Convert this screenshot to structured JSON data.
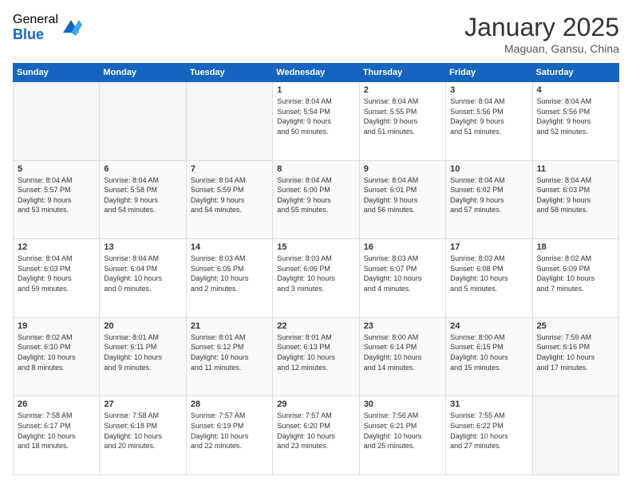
{
  "logo": {
    "general": "General",
    "blue": "Blue"
  },
  "header": {
    "title": "January 2025",
    "subtitle": "Maguan, Gansu, China"
  },
  "weekdays": [
    "Sunday",
    "Monday",
    "Tuesday",
    "Wednesday",
    "Thursday",
    "Friday",
    "Saturday"
  ],
  "weeks": [
    [
      {
        "day": "",
        "info": ""
      },
      {
        "day": "",
        "info": ""
      },
      {
        "day": "",
        "info": ""
      },
      {
        "day": "1",
        "info": "Sunrise: 8:04 AM\nSunset: 5:54 PM\nDaylight: 9 hours\nand 50 minutes."
      },
      {
        "day": "2",
        "info": "Sunrise: 8:04 AM\nSunset: 5:55 PM\nDaylight: 9 hours\nand 51 minutes."
      },
      {
        "day": "3",
        "info": "Sunrise: 8:04 AM\nSunset: 5:56 PM\nDaylight: 9 hours\nand 51 minutes."
      },
      {
        "day": "4",
        "info": "Sunrise: 8:04 AM\nSunset: 5:56 PM\nDaylight: 9 hours\nand 52 minutes."
      }
    ],
    [
      {
        "day": "5",
        "info": "Sunrise: 8:04 AM\nSunset: 5:57 PM\nDaylight: 9 hours\nand 53 minutes."
      },
      {
        "day": "6",
        "info": "Sunrise: 8:04 AM\nSunset: 5:58 PM\nDaylight: 9 hours\nand 54 minutes."
      },
      {
        "day": "7",
        "info": "Sunrise: 8:04 AM\nSunset: 5:59 PM\nDaylight: 9 hours\nand 54 minutes."
      },
      {
        "day": "8",
        "info": "Sunrise: 8:04 AM\nSunset: 6:00 PM\nDaylight: 9 hours\nand 55 minutes."
      },
      {
        "day": "9",
        "info": "Sunrise: 8:04 AM\nSunset: 6:01 PM\nDaylight: 9 hours\nand 56 minutes."
      },
      {
        "day": "10",
        "info": "Sunrise: 8:04 AM\nSunset: 6:02 PM\nDaylight: 9 hours\nand 57 minutes."
      },
      {
        "day": "11",
        "info": "Sunrise: 8:04 AM\nSunset: 6:03 PM\nDaylight: 9 hours\nand 58 minutes."
      }
    ],
    [
      {
        "day": "12",
        "info": "Sunrise: 8:04 AM\nSunset: 6:03 PM\nDaylight: 9 hours\nand 59 minutes."
      },
      {
        "day": "13",
        "info": "Sunrise: 8:04 AM\nSunset: 6:04 PM\nDaylight: 10 hours\nand 0 minutes."
      },
      {
        "day": "14",
        "info": "Sunrise: 8:03 AM\nSunset: 6:05 PM\nDaylight: 10 hours\nand 2 minutes."
      },
      {
        "day": "15",
        "info": "Sunrise: 8:03 AM\nSunset: 6:06 PM\nDaylight: 10 hours\nand 3 minutes."
      },
      {
        "day": "16",
        "info": "Sunrise: 8:03 AM\nSunset: 6:07 PM\nDaylight: 10 hours\nand 4 minutes."
      },
      {
        "day": "17",
        "info": "Sunrise: 8:03 AM\nSunset: 6:08 PM\nDaylight: 10 hours\nand 5 minutes."
      },
      {
        "day": "18",
        "info": "Sunrise: 8:02 AM\nSunset: 6:09 PM\nDaylight: 10 hours\nand 7 minutes."
      }
    ],
    [
      {
        "day": "19",
        "info": "Sunrise: 8:02 AM\nSunset: 6:10 PM\nDaylight: 10 hours\nand 8 minutes."
      },
      {
        "day": "20",
        "info": "Sunrise: 8:01 AM\nSunset: 6:11 PM\nDaylight: 10 hours\nand 9 minutes."
      },
      {
        "day": "21",
        "info": "Sunrise: 8:01 AM\nSunset: 6:12 PM\nDaylight: 10 hours\nand 11 minutes."
      },
      {
        "day": "22",
        "info": "Sunrise: 8:01 AM\nSunset: 6:13 PM\nDaylight: 10 hours\nand 12 minutes."
      },
      {
        "day": "23",
        "info": "Sunrise: 8:00 AM\nSunset: 6:14 PM\nDaylight: 10 hours\nand 14 minutes."
      },
      {
        "day": "24",
        "info": "Sunrise: 8:00 AM\nSunset: 6:15 PM\nDaylight: 10 hours\nand 15 minutes."
      },
      {
        "day": "25",
        "info": "Sunrise: 7:59 AM\nSunset: 6:16 PM\nDaylight: 10 hours\nand 17 minutes."
      }
    ],
    [
      {
        "day": "26",
        "info": "Sunrise: 7:58 AM\nSunset: 6:17 PM\nDaylight: 10 hours\nand 18 minutes."
      },
      {
        "day": "27",
        "info": "Sunrise: 7:58 AM\nSunset: 6:18 PM\nDaylight: 10 hours\nand 20 minutes."
      },
      {
        "day": "28",
        "info": "Sunrise: 7:57 AM\nSunset: 6:19 PM\nDaylight: 10 hours\nand 22 minutes."
      },
      {
        "day": "29",
        "info": "Sunrise: 7:57 AM\nSunset: 6:20 PM\nDaylight: 10 hours\nand 23 minutes."
      },
      {
        "day": "30",
        "info": "Sunrise: 7:56 AM\nSunset: 6:21 PM\nDaylight: 10 hours\nand 25 minutes."
      },
      {
        "day": "31",
        "info": "Sunrise: 7:55 AM\nSunset: 6:22 PM\nDaylight: 10 hours\nand 27 minutes."
      },
      {
        "day": "",
        "info": ""
      }
    ]
  ]
}
